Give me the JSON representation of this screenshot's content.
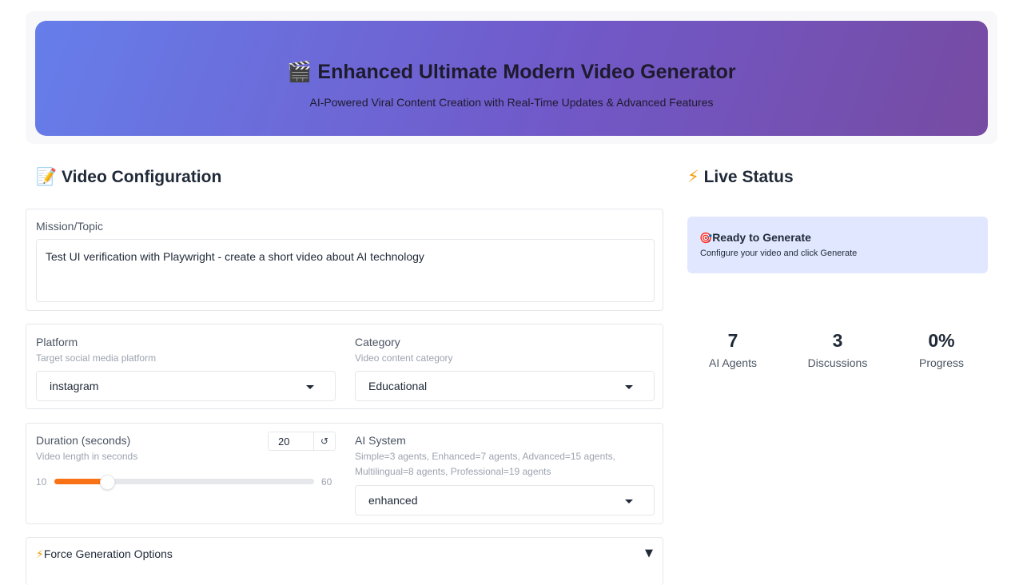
{
  "header": {
    "title": "🎬 Enhanced Ultimate Modern Video Generator",
    "subtitle": "AI-Powered Viral Content Creation with Real-Time Updates & Advanced Features"
  },
  "config": {
    "title_emoji": "📝",
    "title": "Video Configuration",
    "mission": {
      "label": "Mission/Topic",
      "value": "Test UI verification with Playwright - create a short video about AI technology"
    },
    "platform": {
      "label": "Platform",
      "hint": "Target social media platform",
      "value": "instagram"
    },
    "category": {
      "label": "Category",
      "hint": "Video content category",
      "value": "Educational"
    },
    "duration": {
      "label": "Duration (seconds)",
      "hint": "Video length in seconds",
      "value": "20",
      "min": "10",
      "max": "60",
      "fraction": 0.2,
      "reset_icon": "↺"
    },
    "ai_system": {
      "label": "AI System",
      "hint": "Simple=3 agents, Enhanced=7 agents, Advanced=15 agents, Multilingual=8 agents, Professional=19 agents",
      "value": "enhanced"
    },
    "force": {
      "icon": "⚡",
      "label": "Force Generation Options",
      "toggle": "▼"
    }
  },
  "status": {
    "title_emoji": "⚡",
    "title": "Live Status",
    "box_icon": "🎯",
    "box_title": "Ready to Generate",
    "box_text": "Configure your video and click Generate",
    "stats": [
      {
        "value": "7",
        "label": "AI Agents"
      },
      {
        "value": "3",
        "label": "Discussions"
      },
      {
        "value": "0%",
        "label": "Progress"
      }
    ]
  },
  "colors": {
    "accent": "#f97316",
    "header_start": "#667eea",
    "header_end": "#764ba2",
    "status_bg": "#e0e7ff"
  }
}
